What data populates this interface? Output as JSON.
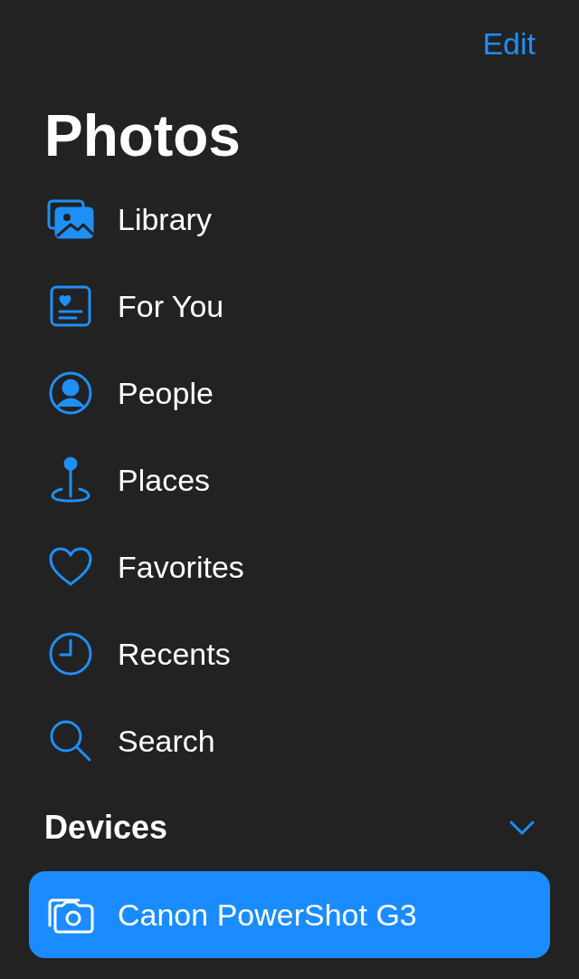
{
  "edit_button": "Edit",
  "title": "Photos",
  "items": [
    {
      "label": "Library",
      "selected": false
    },
    {
      "label": "For You",
      "selected": false
    },
    {
      "label": "People",
      "selected": false
    },
    {
      "label": "Places",
      "selected": false
    },
    {
      "label": "Favorites",
      "selected": false
    },
    {
      "label": "Recents",
      "selected": false
    },
    {
      "label": "Search",
      "selected": false
    }
  ],
  "sections": [
    {
      "title": "Devices",
      "expanded": true,
      "items": [
        {
          "label": "Canon PowerShot G3",
          "selected": true
        }
      ]
    }
  ]
}
